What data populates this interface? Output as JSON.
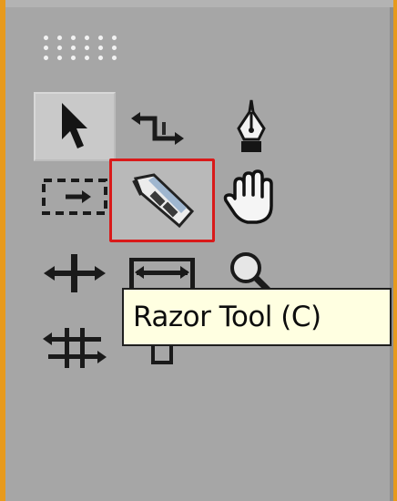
{
  "tools_panel": {
    "tools": [
      {
        "id": "selection",
        "icon": "arrow-cursor-icon",
        "state": "selected"
      },
      {
        "id": "ripple-edit",
        "icon": "ripple-edit-icon",
        "state": "normal"
      },
      {
        "id": "pen",
        "icon": "pen-nib-icon",
        "state": "normal"
      },
      {
        "id": "track-select",
        "icon": "track-select-icon",
        "state": "normal"
      },
      {
        "id": "razor",
        "icon": "razor-blade-icon",
        "state": "highlighted"
      },
      {
        "id": "hand",
        "icon": "hand-icon",
        "state": "normal"
      },
      {
        "id": "rolling-edit",
        "icon": "rolling-edit-icon",
        "state": "normal"
      },
      {
        "id": "rate-stretch",
        "icon": "rate-stretch-icon",
        "state": "normal"
      },
      {
        "id": "zoom",
        "icon": "magnifier-icon",
        "state": "normal"
      },
      {
        "id": "slip",
        "icon": "slip-icon",
        "state": "normal"
      },
      {
        "id": "slide",
        "icon": "slide-icon",
        "state": "normal"
      }
    ],
    "highlight_color": "#d91a1a"
  },
  "tooltip": {
    "text": "Razor Tool (C)"
  }
}
